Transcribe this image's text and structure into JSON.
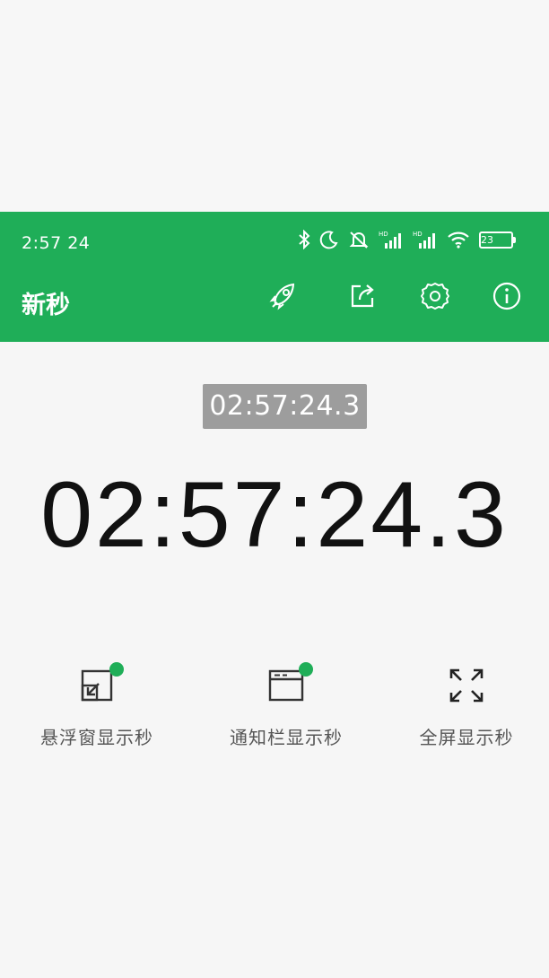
{
  "status_bar": {
    "time": "2:57 24",
    "battery_level": "23",
    "icons": [
      "bluetooth-icon",
      "moon-icon",
      "mute-alarm-icon",
      "hd-signal-icon",
      "hd-signal-icon",
      "wifi-icon",
      "battery-icon"
    ]
  },
  "app_bar": {
    "title": "新秒",
    "actions": [
      "rocket-icon",
      "share-icon",
      "gear-icon",
      "info-icon"
    ]
  },
  "clock": {
    "mini": "02:57:24.3",
    "big": "02:57:24.3"
  },
  "modes": [
    {
      "label": "悬浮窗显示秒",
      "icon": "floating-window-icon",
      "active": true
    },
    {
      "label": "通知栏显示秒",
      "icon": "notification-bar-icon",
      "active": true
    },
    {
      "label": "全屏显示秒",
      "icon": "fullscreen-icon",
      "active": false
    }
  ],
  "colors": {
    "brand_green": "#1fae58",
    "mini_clock_bg": "#9d9d9d",
    "background": "#f6f6f6"
  }
}
